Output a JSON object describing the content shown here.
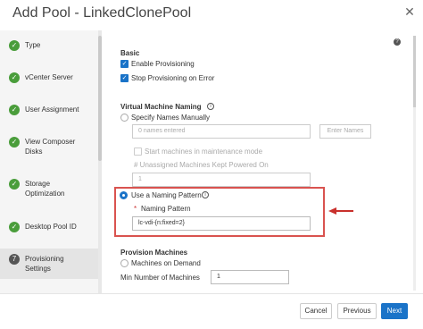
{
  "dialog": {
    "title": "Add Pool - LinkedClonePool",
    "close_icon": "close-icon"
  },
  "steps": [
    {
      "label": "Type",
      "state": "done",
      "icon": "check"
    },
    {
      "label": "vCenter Server",
      "state": "done",
      "icon": "check"
    },
    {
      "label": "User Assignment",
      "state": "done",
      "icon": "check"
    },
    {
      "label": "View Composer\nDisks",
      "state": "done",
      "icon": "check"
    },
    {
      "label": "Storage\nOptimization",
      "state": "done",
      "icon": "check"
    },
    {
      "label": "Desktop Pool ID",
      "state": "done",
      "icon": "check"
    },
    {
      "label": "Provisioning\nSettings",
      "state": "current",
      "number": "7"
    }
  ],
  "basic": {
    "title": "Basic",
    "enable_provisioning": {
      "label": "Enable Provisioning",
      "checked": true
    },
    "stop_on_error": {
      "label": "Stop Provisioning on Error",
      "checked": true
    }
  },
  "naming": {
    "title": "Virtual Machine Naming",
    "specify_manually": {
      "label": "Specify Names Manually",
      "selected": false
    },
    "names_entered": "0 names entered",
    "enter_names_button": "Enter Names",
    "start_maintenance": "Start machines in maintenance mode",
    "unassigned_label": "# Unassigned Machines Kept Powered On",
    "unassigned_value": "1",
    "use_pattern": {
      "label": "Use a Naming Pattern",
      "selected": true
    },
    "pattern_label": "Naming Pattern",
    "pattern_value": "lc-vdi-{n:fixed=2}",
    "required_marker": "*"
  },
  "provision": {
    "title": "Provision Machines",
    "on_demand": {
      "label": "Machines on Demand",
      "selected": false
    },
    "min_label": "Min Number of Machines",
    "min_value": "1"
  },
  "footer": {
    "cancel": "Cancel",
    "previous": "Previous",
    "next": "Next"
  },
  "colors": {
    "accent": "#1a73c8",
    "step_done": "#4a9d3b",
    "highlight": "#d9534f"
  }
}
